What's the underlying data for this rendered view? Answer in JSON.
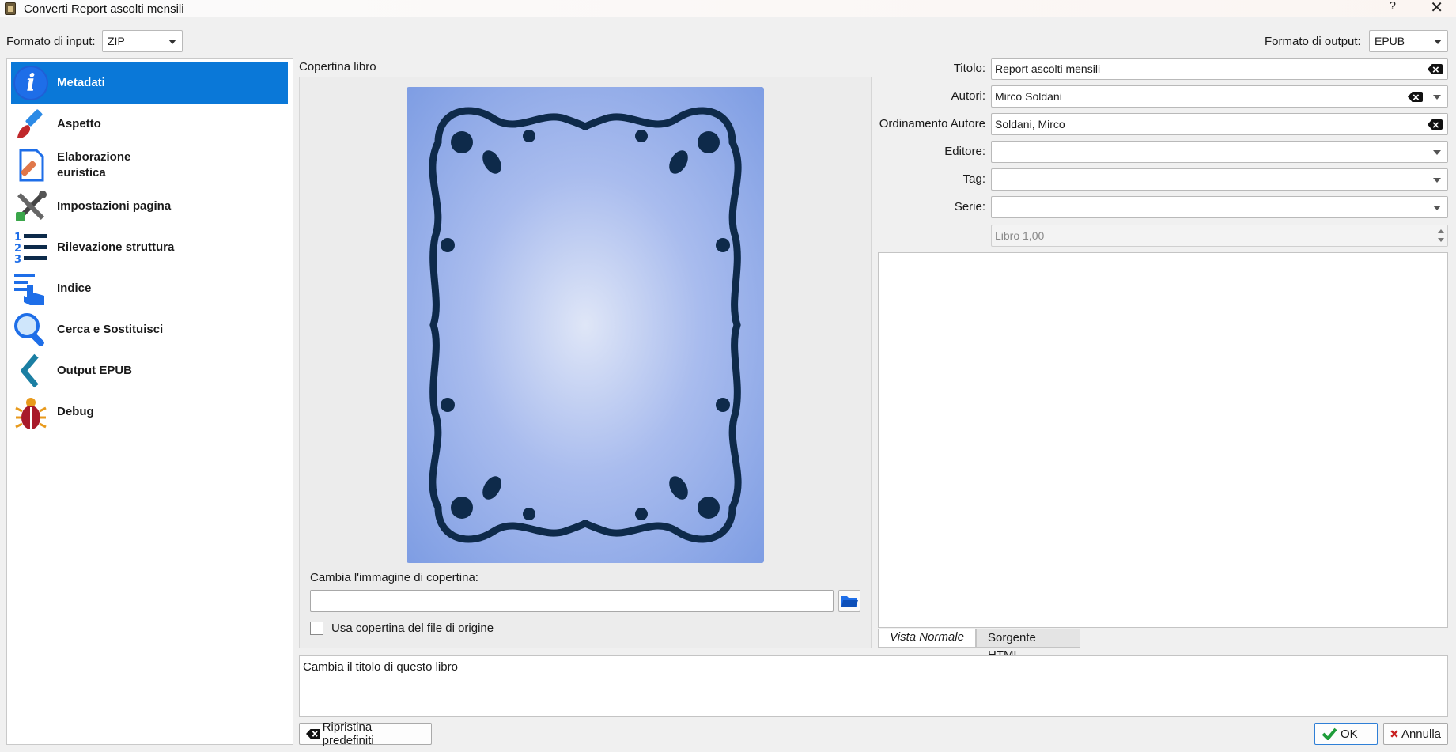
{
  "window": {
    "title": "Converti Report ascolti mensili",
    "help_label": "?",
    "close_label": "✕"
  },
  "formats": {
    "input_label": "Formato di input:",
    "input_value": "ZIP",
    "output_label": "Formato di output:",
    "output_value": "EPUB"
  },
  "sidebar": {
    "items": [
      {
        "label": "Metadati",
        "icon": "info-icon",
        "active": true
      },
      {
        "label": "Aspetto",
        "icon": "brush-icon"
      },
      {
        "label": "Elaborazione euristica",
        "icon": "heuristics-icon"
      },
      {
        "label": "Impostazioni pagina",
        "icon": "tools-icon"
      },
      {
        "label": "Rilevazione struttura",
        "icon": "numbered-list-icon"
      },
      {
        "label": "Indice",
        "icon": "toc-icon"
      },
      {
        "label": "Cerca e Sostituisci",
        "icon": "search-icon"
      },
      {
        "label": "Output EPUB",
        "icon": "chevron-left-icon"
      },
      {
        "label": "Debug",
        "icon": "bug-icon"
      }
    ]
  },
  "cover": {
    "group_label": "Copertina libro",
    "change_label": "Cambia l'immagine di copertina:",
    "path_value": "",
    "use_source_label": "Usa copertina del file di origine",
    "use_source_checked": false
  },
  "metadata": {
    "title_label": "Titolo:",
    "title_value": "Report ascolti mensili",
    "authors_label": "Autori:",
    "authors_value": "Mirco Soldani",
    "author_sort_label": "Ordinamento Autore",
    "author_sort_value": "Soldani, Mirco",
    "publisher_label": "Editore:",
    "publisher_value": "",
    "tags_label": "Tag:",
    "tags_value": "",
    "series_label": "Serie:",
    "series_value": "",
    "series_index_value": "Libro 1,00"
  },
  "comments": {
    "tab_normal": "Vista Normale",
    "tab_html": "Sorgente HTML"
  },
  "message": "Cambia il titolo di questo libro",
  "buttons": {
    "restore_defaults": "Ripristina predefiniti",
    "ok": "OK",
    "cancel": "Annulla"
  },
  "colors": {
    "accent": "#0a78d8",
    "ok_check": "#1f9d3a",
    "cancel_x": "#c81e1e"
  }
}
